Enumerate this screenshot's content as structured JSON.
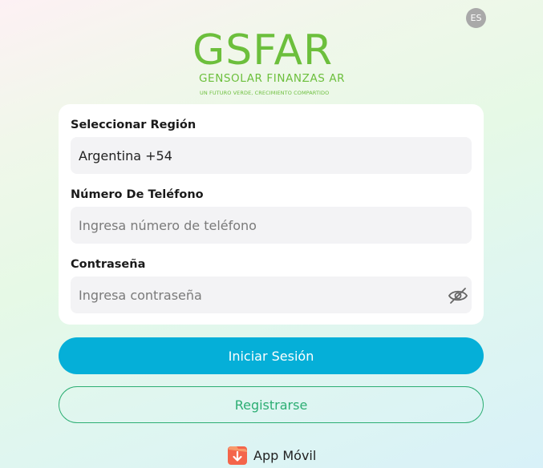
{
  "language_badge": "ES",
  "logo": {
    "wordmark": "GSFAR",
    "name": "GENSOLAR FINANZAS AR",
    "tagline": "UN FUTURO VERDE, CRECIMIENTO COMPARTIDO"
  },
  "form": {
    "region_label": "Seleccionar Región",
    "region_value": "Argentina +54",
    "phone_label": "Número De Teléfono",
    "phone_placeholder": "Ingresa número de teléfono",
    "password_label": "Contraseña",
    "password_placeholder": "Ingresa contraseña"
  },
  "buttons": {
    "login": "Iniciar Sesión",
    "register": "Registrarse"
  },
  "app_link": {
    "label": "App Móvil",
    "icon": "download-app-icon"
  },
  "colors": {
    "primary": "#05afd8",
    "secondary": "#2cae73",
    "brand_green": "#6cbf3c"
  }
}
